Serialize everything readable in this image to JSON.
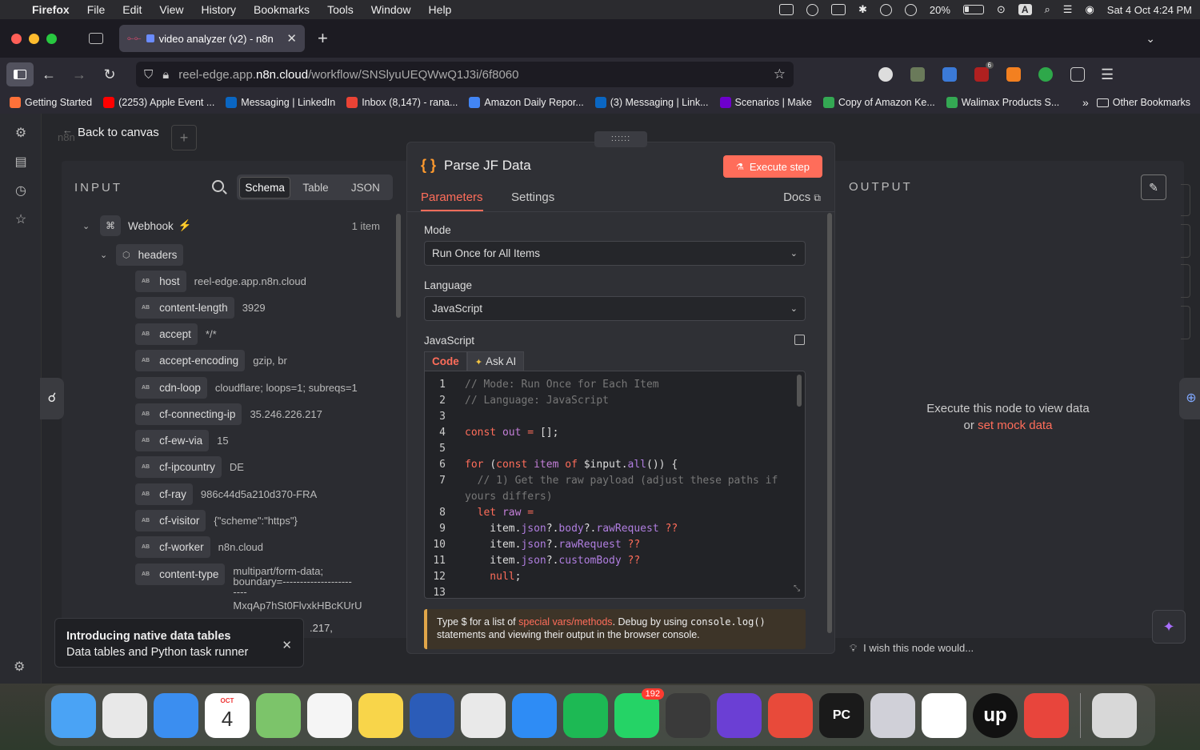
{
  "menubar": {
    "items": [
      "Firefox",
      "File",
      "Edit",
      "View",
      "History",
      "Bookmarks",
      "Tools",
      "Window",
      "Help"
    ],
    "battery": "20%",
    "input_letter": "A",
    "clock": "Sat 4 Oct  4:24 PM"
  },
  "browser": {
    "tab_title": "video analyzer (v2) - n8n",
    "url_prefix": "reel-edge.app.",
    "url_domain": "n8n.cloud",
    "url_path": "/workflow/SNSlyuUEQWwQ1J3i/6f8060",
    "extension_badge": "6",
    "bookmarks": [
      {
        "label": "Getting Started",
        "color": "#ff7139"
      },
      {
        "label": "(2253) Apple Event ...",
        "color": "#ff0000"
      },
      {
        "label": "Messaging | LinkedIn",
        "color": "#0a66c2"
      },
      {
        "label": "Inbox (8,147) - rana...",
        "color": "#ea4335"
      },
      {
        "label": "Amazon Daily Repor...",
        "color": "#4285f4"
      },
      {
        "label": "(3) Messaging | Link...",
        "color": "#0a66c2"
      },
      {
        "label": "Scenarios | Make",
        "color": "#6d00cc"
      },
      {
        "label": "Copy of Amazon Ke...",
        "color": "#34a853"
      },
      {
        "label": "Walimax Products S...",
        "color": "#34a853"
      }
    ],
    "other_bookmarks": "Other Bookmarks"
  },
  "canvas": {
    "back_label": "Back to canvas",
    "brand_faint": "n8n"
  },
  "input": {
    "title": "INPUT",
    "views": [
      "Schema",
      "Table",
      "JSON"
    ],
    "active_view": "Schema",
    "root_node": "Webhook",
    "item_count": "1 item",
    "group": "headers",
    "type_badge": "AB",
    "fields": [
      {
        "key": "host",
        "value": "reel-edge.app.n8n.cloud"
      },
      {
        "key": "content-length",
        "value": "3929"
      },
      {
        "key": "accept",
        "value": "*/*"
      },
      {
        "key": "accept-encoding",
        "value": "gzip, br"
      },
      {
        "key": "cdn-loop",
        "value": "cloudflare; loops=1; subreqs=1"
      },
      {
        "key": "cf-connecting-ip",
        "value": "35.246.226.217"
      },
      {
        "key": "cf-ew-via",
        "value": "15"
      },
      {
        "key": "cf-ipcountry",
        "value": "DE"
      },
      {
        "key": "cf-ray",
        "value": "986c44d5a210d370-FRA"
      },
      {
        "key": "cf-visitor",
        "value": "{\"scheme\":\"https\"}"
      },
      {
        "key": "cf-worker",
        "value": "n8n.cloud"
      },
      {
        "key": "content-type",
        "value_lines": [
          "multipart/form-data;",
          "boundary=--------------------",
          "----",
          "MxqAp7hSt0FlvxkHBcKUrU"
        ]
      }
    ],
    "partial_tail": ".217,"
  },
  "toast": {
    "title": "Introducing native data tables",
    "body": "Data tables and Python task runner"
  },
  "node": {
    "title": "Parse JF Data",
    "execute_label": "Execute step",
    "tabs": [
      "Parameters",
      "Settings"
    ],
    "docs_label": "Docs",
    "mode_label": "Mode",
    "mode_value": "Run Once for All Items",
    "language_label": "Language",
    "language_value": "JavaScript",
    "code_label": "JavaScript",
    "code_tabs": [
      "Code",
      "Ask AI"
    ],
    "code_lines": [
      {
        "n": "1",
        "parts": [
          {
            "c": "c-com",
            "t": "// Mode: Run Once for Each Item"
          }
        ]
      },
      {
        "n": "2",
        "parts": [
          {
            "c": "c-com",
            "t": "// Language: JavaScript"
          }
        ]
      },
      {
        "n": "3",
        "parts": []
      },
      {
        "n": "4",
        "parts": [
          {
            "c": "c-kw",
            "t": "const "
          },
          {
            "c": "c-var",
            "t": "out"
          },
          {
            "c": "c-kw",
            "t": " = "
          },
          {
            "c": "c-def",
            "t": "[];"
          }
        ]
      },
      {
        "n": "5",
        "parts": []
      },
      {
        "n": "6",
        "parts": [
          {
            "c": "c-kw",
            "t": "for "
          },
          {
            "c": "c-def",
            "t": "("
          },
          {
            "c": "c-kw",
            "t": "const "
          },
          {
            "c": "c-var",
            "t": "item"
          },
          {
            "c": "c-kw",
            "t": " of "
          },
          {
            "c": "c-def",
            "t": "$input."
          },
          {
            "c": "c-prop",
            "t": "all"
          },
          {
            "c": "c-def",
            "t": "()) {"
          }
        ]
      },
      {
        "n": "7",
        "parts": [
          {
            "c": "c-com",
            "t": "  // 1) Get the raw payload (adjust these paths if"
          }
        ]
      },
      {
        "n": "",
        "parts": [
          {
            "c": "c-com",
            "t": "yours differs)"
          }
        ]
      },
      {
        "n": "8",
        "parts": [
          {
            "c": "c-def",
            "t": "  "
          },
          {
            "c": "c-kw",
            "t": "let "
          },
          {
            "c": "c-var",
            "t": "raw"
          },
          {
            "c": "c-kw",
            "t": " ="
          }
        ]
      },
      {
        "n": "9",
        "parts": [
          {
            "c": "c-def",
            "t": "    item."
          },
          {
            "c": "c-prop",
            "t": "json"
          },
          {
            "c": "c-def",
            "t": "?."
          },
          {
            "c": "c-prop",
            "t": "body"
          },
          {
            "c": "c-def",
            "t": "?."
          },
          {
            "c": "c-prop",
            "t": "rawRequest"
          },
          {
            "c": "c-kw",
            "t": " ??"
          }
        ]
      },
      {
        "n": "10",
        "parts": [
          {
            "c": "c-def",
            "t": "    item."
          },
          {
            "c": "c-prop",
            "t": "json"
          },
          {
            "c": "c-def",
            "t": "?."
          },
          {
            "c": "c-prop",
            "t": "rawRequest"
          },
          {
            "c": "c-kw",
            "t": " ??"
          }
        ]
      },
      {
        "n": "11",
        "parts": [
          {
            "c": "c-def",
            "t": "    item."
          },
          {
            "c": "c-prop",
            "t": "json"
          },
          {
            "c": "c-def",
            "t": "?."
          },
          {
            "c": "c-prop",
            "t": "customBody"
          },
          {
            "c": "c-kw",
            "t": " ??"
          }
        ]
      },
      {
        "n": "12",
        "parts": [
          {
            "c": "c-nul",
            "t": "    null"
          },
          {
            "c": "c-def",
            "t": ";"
          }
        ]
      },
      {
        "n": "13",
        "parts": []
      }
    ],
    "hint_prefix": "Type $ for a list of ",
    "hint_link": "special vars/methods",
    "hint_mid": ". Debug by using ",
    "hint_code": "console.log()",
    "hint_suffix": "statements and viewing their output in the browser console."
  },
  "output": {
    "title": "OUTPUT",
    "message": "Execute this node to view data",
    "or_text": "or ",
    "mock_link": "set mock data",
    "wish_text": "I wish this node would..."
  },
  "dock": {
    "calendar_month": "OCT",
    "calendar_day": "4",
    "whatsapp_badge": "192",
    "pycharm_label": "PC",
    "upwork_label": "up",
    "apps": [
      {
        "name": "finder-icon",
        "color": "#4aa3f5"
      },
      {
        "name": "launchpad-icon",
        "color": "#e8e8e8"
      },
      {
        "name": "mail-icon",
        "color": "#3b8ef0"
      },
      {
        "name": "calendar-icon",
        "color": "#ffffff"
      },
      {
        "name": "maps-icon",
        "color": "#7cc46a"
      },
      {
        "name": "reminders-icon",
        "color": "#f5f5f5"
      },
      {
        "name": "notes-icon",
        "color": "#f8d54a"
      },
      {
        "name": "word-icon",
        "color": "#2b5cb8"
      },
      {
        "name": "chrome-icon",
        "color": "#e9e9e9"
      },
      {
        "name": "app-store-icon",
        "color": "#2e8cf5"
      },
      {
        "name": "spotify-icon",
        "color": "#1db954"
      },
      {
        "name": "whatsapp-icon",
        "color": "#25d366"
      },
      {
        "name": "calculator-icon",
        "color": "#3a3a3a"
      },
      {
        "name": "firefox-icon",
        "color": "#6b3fd4"
      },
      {
        "name": "ticktick-icon",
        "color": "#e84a3a"
      },
      {
        "name": "pycharm-icon",
        "color": "#1a1a1a"
      },
      {
        "name": "iphone-mirroring-icon",
        "color": "#d0d0d8"
      },
      {
        "name": "slack-icon",
        "color": "#ffffff"
      },
      {
        "name": "upwork-icon",
        "color": "#111111"
      },
      {
        "name": "wps-office-icon",
        "color": "#e8453c"
      },
      {
        "name": "trash-icon",
        "color": "#d8d8d8"
      }
    ]
  }
}
